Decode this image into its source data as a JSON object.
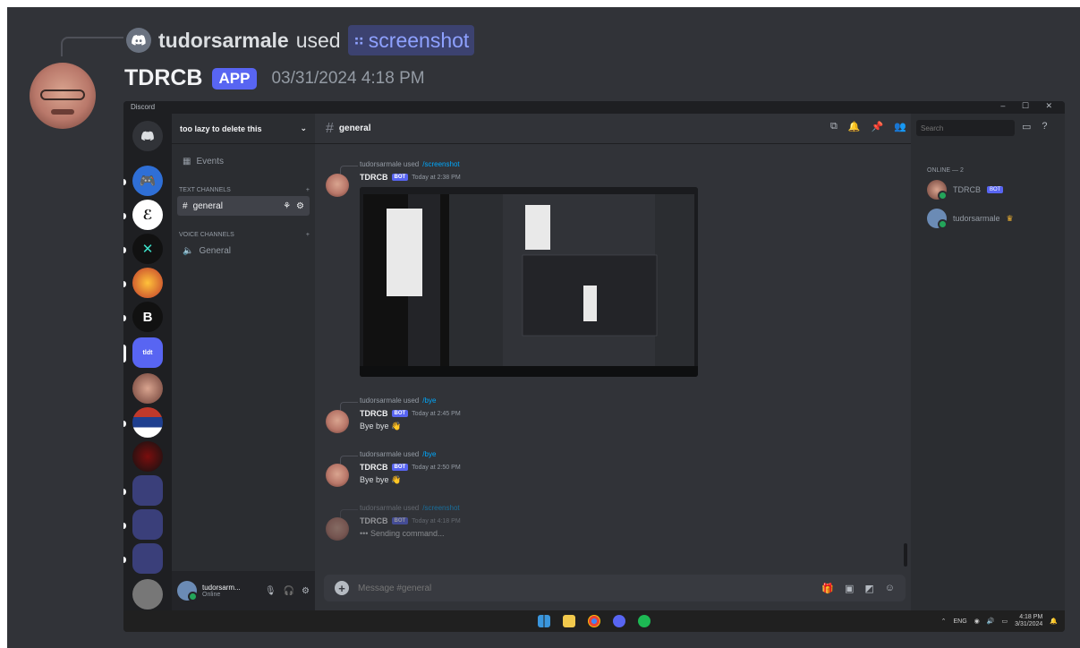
{
  "outer": {
    "reply_user": "tudorsarmale",
    "reply_used": "used",
    "reply_command": "screenshot",
    "author": "TDRCB",
    "badge": "APP",
    "timestamp": "03/31/2024 4:18 PM"
  },
  "shot": {
    "window_title": "Discord",
    "window_controls": "– ☐ ✕",
    "server_name": "too lazy to delete this",
    "events": "Events",
    "cat_text": "TEXT CHANNELS",
    "cat_voice": "VOICE CHANNELS",
    "channel_general": "general",
    "voice_general": "General",
    "chat_channel": "general",
    "search_placeholder": "Search",
    "members_header": "ONLINE — 2",
    "members": [
      {
        "name": "TDRCB",
        "badge": "BOT"
      },
      {
        "name": "tudorsarmale"
      }
    ],
    "user_panel": {
      "name": "tudorsarm...",
      "status": "Online"
    },
    "composer_placeholder": "Message #general",
    "messages": [
      {
        "reply_user": "tudorsarmale used",
        "reply_cmd": "/screenshot",
        "author": "TDRCB",
        "bot": "BOT",
        "time": "Today at 2:38 PM",
        "body": ""
      },
      {
        "reply_user": "tudorsarmale used",
        "reply_cmd": "/bye",
        "author": "TDRCB",
        "bot": "BOT",
        "time": "Today at 2:45 PM",
        "body": "Bye bye 👋"
      },
      {
        "reply_user": "tudorsarmale used",
        "reply_cmd": "/bye",
        "author": "TDRCB",
        "bot": "BOT",
        "time": "Today at 2:50 PM",
        "body": "Bye bye 👋"
      },
      {
        "reply_user": "tudorsarmale used",
        "reply_cmd": "/screenshot",
        "author": "TDRCB",
        "bot": "BOT",
        "time": "Today at 4:18 PM",
        "body": "••• Sending command..."
      }
    ],
    "tray": {
      "lang": "ENG",
      "time": "4:18 PM",
      "date": "3/31/2024"
    }
  },
  "colors": {
    "blurple": "#5865f2",
    "bg": "#313338",
    "sidebar": "#2b2d31",
    "rail": "#1e1f22",
    "online": "#23a55a",
    "link": "#00a8fc"
  }
}
